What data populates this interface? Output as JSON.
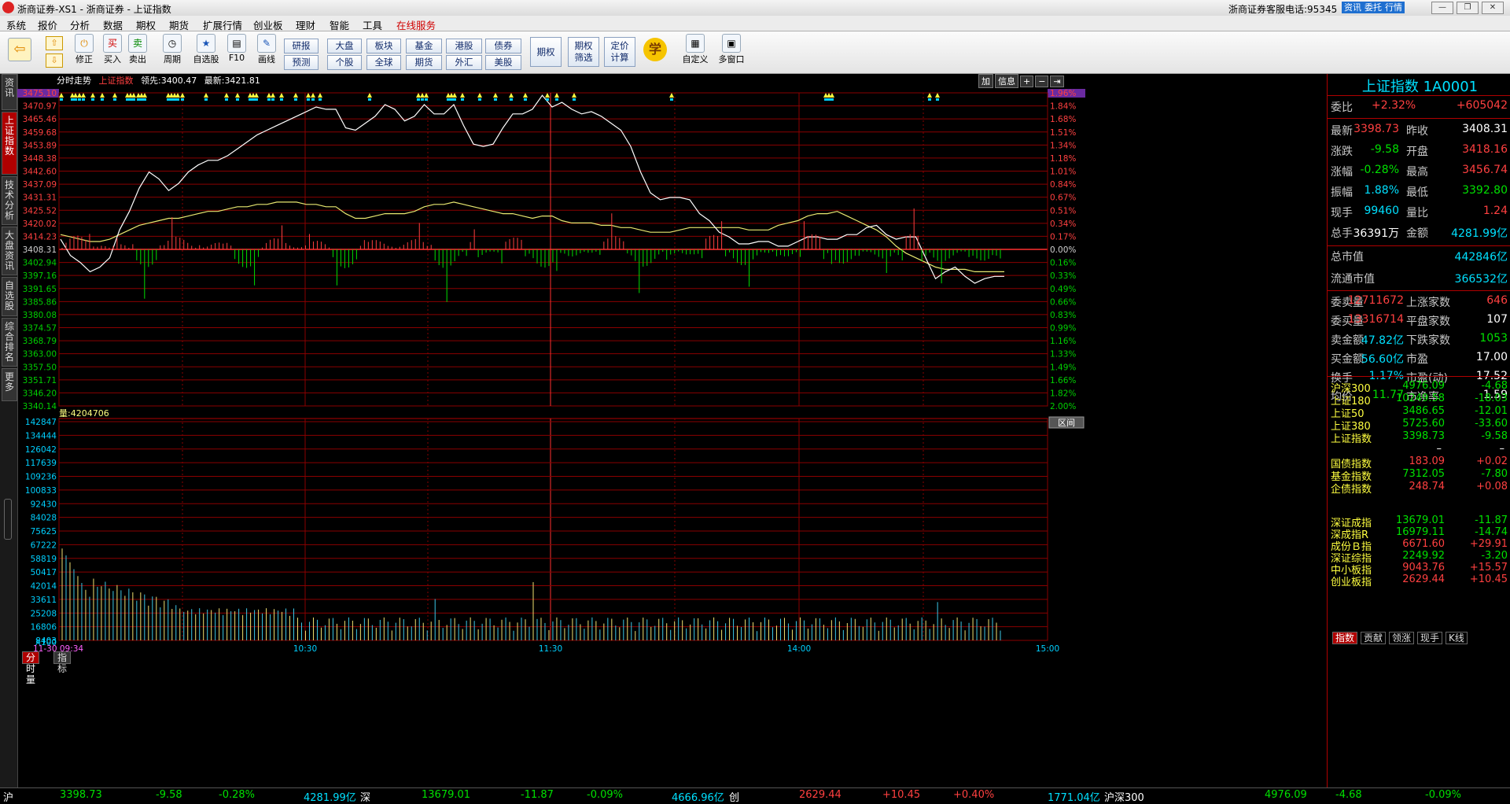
{
  "window": {
    "title": "浙商证券-XS1 - 浙商证券 - 上证指数",
    "phone_label": "浙商证券客服电话:",
    "phone": "95345",
    "tb_buttons": [
      "资讯",
      "委托",
      "行情"
    ],
    "win_buttons": [
      "—",
      "❐",
      "✕"
    ]
  },
  "menu": [
    "系统",
    "报价",
    "分析",
    "数据",
    "期权",
    "期货",
    "扩展行情",
    "创业板",
    "理财",
    "智能",
    "工具",
    "在线服务"
  ],
  "toolbar": {
    "buttons": [
      {
        "label": "",
        "icon": "back-arrow-icon"
      },
      {
        "label": "修正",
        "icon": "power-icon"
      },
      {
        "label": "买入",
        "icon": "buy-icon",
        "glyph": "买"
      },
      {
        "label": "卖出",
        "icon": "sell-icon",
        "glyph": "卖"
      },
      {
        "label": "周期",
        "icon": "clock-icon"
      },
      {
        "label": "自选股",
        "icon": "star-icon"
      },
      {
        "label": "F10",
        "icon": "f10-icon"
      },
      {
        "label": "画线",
        "icon": "pencil-icon"
      }
    ],
    "small_buttons": [
      [
        "研报",
        "预测"
      ],
      [
        "大盘",
        "个股"
      ],
      [
        "板块",
        "全球"
      ],
      [
        "基金",
        "期货"
      ],
      [
        "港股",
        "外汇"
      ],
      [
        "债券",
        "美股"
      ]
    ],
    "big_buttons": [
      "期权",
      "期权筛选",
      "定价计算"
    ],
    "right_buttons": [
      {
        "label": "自定义"
      },
      {
        "label": "多窗口"
      }
    ],
    "learn": "学"
  },
  "left_tabs": [
    "资讯",
    "上证指数",
    "技术分析",
    "大盘资讯",
    "自选股",
    "综合排名",
    "更多"
  ],
  "chart_header": {
    "title": "分时走势",
    "index": "上证指数",
    "lead_label": "领先:",
    "lead": "3400.47",
    "latest_label": "最新:",
    "latest": "3421.81",
    "right_buttons": [
      "加",
      "信息",
      "+",
      "−",
      "⇥"
    ]
  },
  "price_axis": [
    "3475.10",
    "3470.97",
    "3465.46",
    "3459.68",
    "3453.89",
    "3448.38",
    "3442.60",
    "3437.09",
    "3431.31",
    "3425.52",
    "3420.02",
    "3414.23",
    "3408.31",
    "3402.94",
    "3397.16",
    "3391.65",
    "3385.86",
    "3380.08",
    "3374.57",
    "3368.79",
    "3363.00",
    "3357.50",
    "3351.71",
    "3346.20",
    "3340.14"
  ],
  "pct_axis": [
    "1.96%",
    "1.84%",
    "1.68%",
    "1.51%",
    "1.34%",
    "1.18%",
    "1.01%",
    "0.84%",
    "0.67%",
    "0.51%",
    "0.34%",
    "0.17%",
    "0.00%",
    "0.16%",
    "0.33%",
    "0.49%",
    "0.66%",
    "0.83%",
    "0.99%",
    "1.16%",
    "1.33%",
    "1.49%",
    "1.66%",
    "1.82%",
    "2.00%"
  ],
  "volume_header": {
    "label": "量:",
    "value": "4204706",
    "button": "区间"
  },
  "volume_axis": [
    "142847",
    "134444",
    "126042",
    "117639",
    "109236",
    "100833",
    "92430",
    "84028",
    "75625",
    "67222",
    "58819",
    "50417",
    "42014",
    "33611",
    "25208",
    "16806",
    "8403",
    "X100"
  ],
  "time_axis": {
    "start": "11-30 09:34",
    "ticks": [
      "10:30",
      "11:30",
      "14:00",
      "15:00"
    ]
  },
  "bottom_tabs": [
    "分时量",
    "指标"
  ],
  "colors": {
    "accent": "#b00000",
    "up": "#ff4040",
    "down": "#00e000",
    "price_line": "#ffffff",
    "avg_line": "#e8e870"
  },
  "quote": {
    "title": "上证指数 1A0001",
    "wb_label": "委比",
    "wb_pct": "+2.32%",
    "wb_val": "+605042",
    "rows": [
      [
        "最新",
        "3398.73",
        "昨收",
        "3408.31"
      ],
      [
        "涨跌",
        "-9.58",
        "开盘",
        "3418.16"
      ],
      [
        "涨幅",
        "-0.28%",
        "最高",
        "3456.74"
      ],
      [
        "振幅",
        "1.88%",
        "最低",
        "3392.80"
      ],
      [
        "现手",
        "99460",
        "量比",
        "1.24"
      ],
      [
        "总手",
        "36391万",
        "金额",
        "4281.99亿"
      ]
    ],
    "total_mv": [
      "总市值",
      "442846亿"
    ],
    "float_mv": [
      "流通市值",
      "366532亿"
    ],
    "rows2": [
      [
        "委卖量",
        "12711672",
        "上涨家数",
        "646"
      ],
      [
        "委买量",
        "13316714",
        "平盘家数",
        "107"
      ],
      [
        "卖金额",
        "47.82亿",
        "下跌家数",
        "1053"
      ],
      [
        "买金额",
        "56.60亿",
        "市盈",
        "17.00"
      ],
      [
        "换手",
        "1.17%",
        "市盈(动)",
        "17.52"
      ],
      [
        "均价",
        "11.77",
        "市净率",
        "1.59"
      ]
    ],
    "idx1": [
      [
        "沪深300",
        "4976.09",
        "-4.68"
      ],
      [
        "上证180",
        "10249.58",
        "-18.03"
      ],
      [
        "上证50",
        "3486.65",
        "-12.01"
      ],
      [
        "上证380",
        "5725.60",
        "-33.60"
      ],
      [
        "上证指数",
        "3398.73",
        "-9.58"
      ]
    ],
    "dash": [
      "–",
      "–"
    ],
    "idx2": [
      [
        "国债指数",
        "183.09",
        "+0.02"
      ],
      [
        "基金指数",
        "7312.05",
        "-7.80"
      ],
      [
        "企债指数",
        "248.74",
        "+0.08"
      ]
    ],
    "idx3": [
      [
        "深证成指",
        "13679.01",
        "-11.87"
      ],
      [
        "深成指R",
        "16979.11",
        "-14.74"
      ],
      [
        "成份Ｂ指",
        "6671.60",
        "+29.91"
      ],
      [
        "深证综指",
        "2249.92",
        "-3.20"
      ],
      [
        "中小板指",
        "9043.76",
        "+15.57"
      ],
      [
        "创业板指",
        "2629.44",
        "+10.45"
      ]
    ],
    "tabs": [
      "指数",
      "贡献",
      "领涨",
      "现手",
      "K线"
    ]
  },
  "status": [
    "沪",
    "3398.73",
    "-9.58",
    "-0.28%",
    "4281.99亿",
    "深",
    "13679.01",
    "-11.87",
    "-0.09%",
    "4666.96亿",
    "创",
    "2629.44",
    "+10.45",
    "+0.40%",
    "1771.04亿",
    "沪深300",
    "4976.09",
    "-4.68",
    "-0.09%"
  ]
}
